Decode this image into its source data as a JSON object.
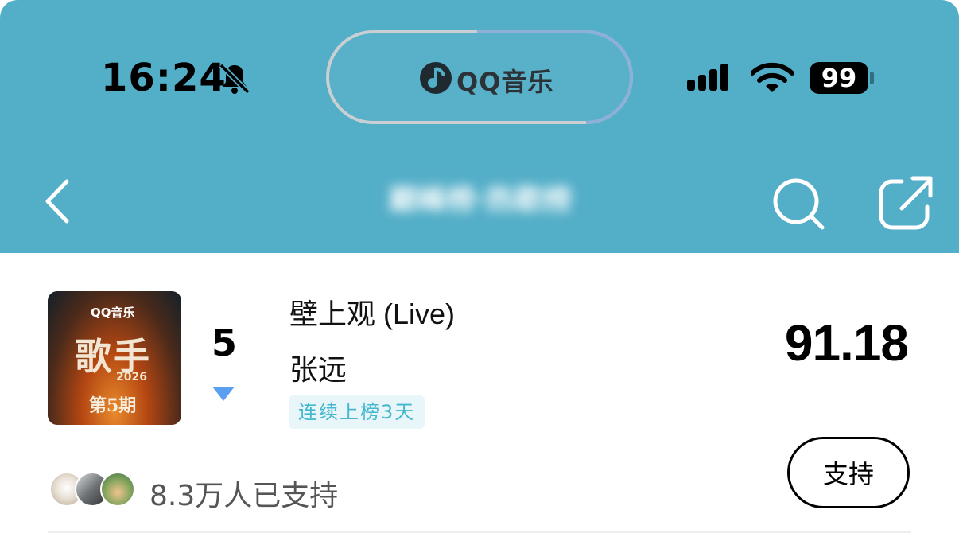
{
  "status_bar": {
    "time": "16:24",
    "battery": "99",
    "island_app": "QQ音乐"
  },
  "nav": {
    "title": "巅峰榜·热歌榜"
  },
  "entry": {
    "cover": {
      "brand": "QQ音乐",
      "title": "歌手",
      "year": "2026",
      "episode": "第5期"
    },
    "rank": "5",
    "rank_trend": "down",
    "song": "壁上观 (Live)",
    "artist": "张远",
    "tag": "连续上榜3天",
    "score": "91.18",
    "support_label": "支持",
    "support_count": "8.3万人已支持"
  },
  "colors": {
    "header_bg": "#53aec8",
    "tag_text": "#45b8cf",
    "tag_bg": "#e8f6fa",
    "trend_down": "#5a9ff0"
  }
}
